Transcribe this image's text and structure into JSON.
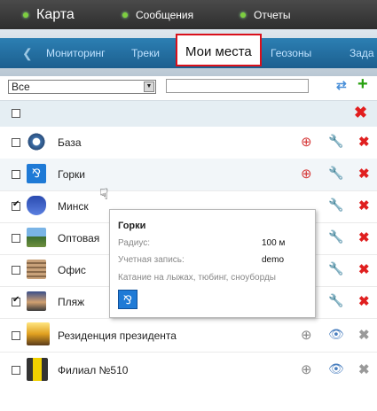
{
  "topnav": {
    "items": [
      {
        "label": "Карта"
      },
      {
        "label": "Сообщения"
      },
      {
        "label": "Отчеты"
      }
    ]
  },
  "tabs": [
    "Мониторинг",
    "Треки",
    "Мои места",
    "Геозоны",
    "Зада"
  ],
  "active_tab": "Мои места",
  "filter": {
    "selected": "Все",
    "search_value": ""
  },
  "places": [
    {
      "name": "База",
      "checked": false,
      "icon": "wheel-icon"
    },
    {
      "name": "Горки",
      "checked": false,
      "icon": "skier-icon"
    },
    {
      "name": "Минск",
      "checked": true,
      "icon": "coat-of-arms-icon"
    },
    {
      "name": "Оптовая",
      "checked": false,
      "icon": "landscape-icon"
    },
    {
      "name": "Офис",
      "checked": false,
      "icon": "building-icon"
    },
    {
      "name": "Пляж",
      "checked": true,
      "icon": "beach-icon"
    },
    {
      "name": "Резиденция президента",
      "checked": false,
      "icon": "residence-icon"
    },
    {
      "name": "Филиал №510",
      "checked": false,
      "icon": "traffic-light-icon"
    }
  ],
  "tooltip": {
    "title": "Горки",
    "radius_label": "Радиус:",
    "radius_value": "100 м",
    "account_label": "Учетная запись:",
    "account_value": "demo",
    "description": "Катание на лыжах, тюбинг, сноуборды"
  },
  "colors": {
    "accent": "#1f6fa7",
    "active_tab_border": "#d9101b",
    "delete": "#e02020"
  }
}
